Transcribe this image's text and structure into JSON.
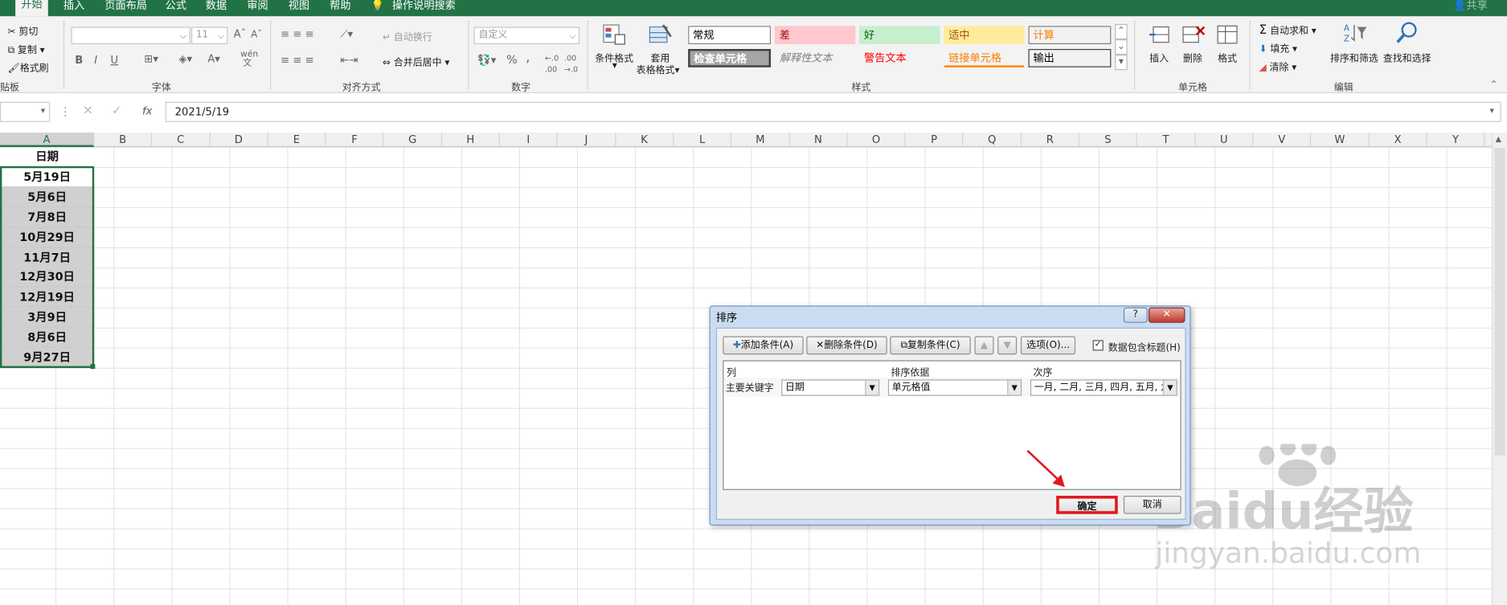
{
  "tabs": {
    "home": "开始",
    "insert": "插入",
    "layout": "页面布局",
    "formulas": "公式",
    "data": "数据",
    "review": "审阅",
    "view": "视图",
    "help": "帮助",
    "tellme": "操作说明搜索",
    "share": "共享"
  },
  "clipboard": {
    "cut": "剪切",
    "copy": "复制",
    "painter": "格式刷",
    "group": "贴板"
  },
  "font": {
    "name_placeholder": "",
    "size": "11",
    "group": "字体",
    "grow": "A",
    "shrink": "A",
    "bold": "B",
    "italic": "I",
    "underline": "U",
    "phonetic": "wén"
  },
  "align": {
    "wrap": "自动换行",
    "merge": "合并后居中",
    "group": "对齐方式"
  },
  "number": {
    "format": "自定义",
    "percent": "%",
    "comma": ",",
    "group": "数字"
  },
  "styles": {
    "cond_format": "条件格式",
    "table_format_1": "套用",
    "table_format_2": "表格格式",
    "normal": "常规",
    "bad": "差",
    "good": "好",
    "neutral": "适中",
    "calc": "计算",
    "check": "检查单元格",
    "explain": "解释性文本",
    "warn": "警告文本",
    "linked": "链接单元格",
    "output": "输出",
    "group": "样式",
    "colors": {
      "bad_bg": "#ffc7ce",
      "bad_fg": "#9c0006",
      "good_bg": "#c6efce",
      "good_fg": "#006100",
      "neutral_bg": "#ffeb9c",
      "neutral_fg": "#9c5700",
      "calc_fg": "#fa7d00",
      "warn_fg": "#ff0000",
      "linked_fg": "#fa7d00",
      "check_bg": "#a5a5a5"
    }
  },
  "cells_grp": {
    "insert": "插入",
    "delete": "删除",
    "format": "格式",
    "group": "单元格"
  },
  "editing": {
    "autosum": "自动求和",
    "fill": "填充",
    "clear": "清除",
    "sort": "排序和筛选",
    "find": "查找和选择",
    "group": "编辑"
  },
  "formula_bar": {
    "fx": "fx",
    "value": "2021/5/19"
  },
  "columns": [
    "A",
    "B",
    "C",
    "D",
    "E",
    "F",
    "G",
    "H",
    "I",
    "J",
    "K",
    "L",
    "M",
    "N",
    "O",
    "P",
    "Q",
    "R",
    "S",
    "T",
    "U",
    "V",
    "W",
    "X",
    "Y"
  ],
  "cells": [
    "日期",
    "5月19日",
    "5月6日",
    "7月8日",
    "10月29日",
    "11月7日",
    "12月30日",
    "12月19日",
    "3月9日",
    "8月6日",
    "9月27日"
  ],
  "dialog": {
    "title": "排序",
    "help": "?",
    "close": "✕",
    "add": "添加条件(A)",
    "delete": "删除条件(D)",
    "copy": "复制条件(C)",
    "options": "选项(O)...",
    "has_header": "数据包含标题(H)",
    "col_header": "列",
    "basis_header": "排序依据",
    "order_header": "次序",
    "primary_key": "主要关键字",
    "key_value": "日期",
    "basis_value": "单元格值",
    "order_value": "一月, 二月, 三月, 四月, 五月, 六月",
    "ok": "确定",
    "cancel": "取消"
  },
  "watermark": {
    "brand": "Baidu经验",
    "url": "jingyan.baidu.com"
  }
}
